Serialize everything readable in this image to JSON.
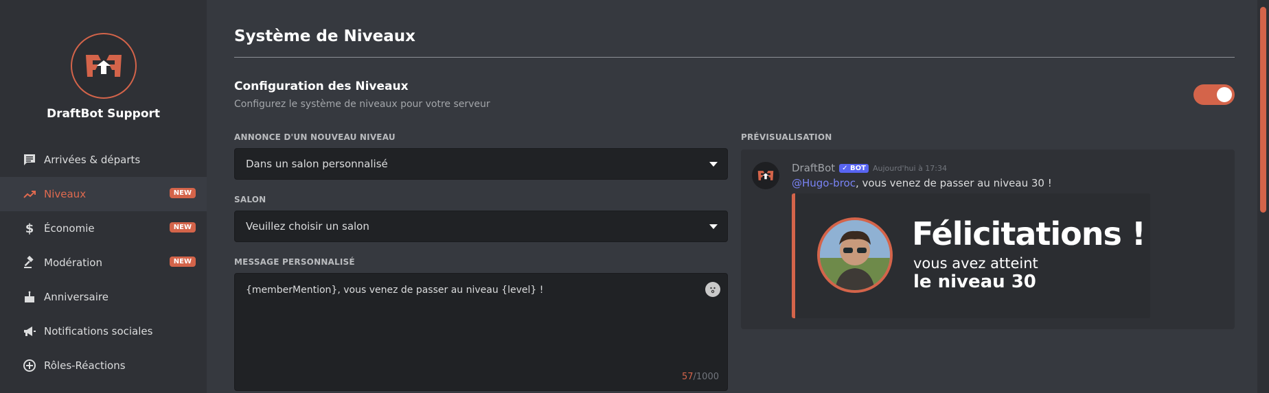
{
  "sidebar": {
    "server_name": "DraftBot Support",
    "items": [
      {
        "label": "Arrivées & départs",
        "icon": "chat-icon",
        "badge": ""
      },
      {
        "label": "Niveaux",
        "icon": "trending-up-icon",
        "badge": "NEW",
        "active": true
      },
      {
        "label": "Économie",
        "icon": "dollar-icon",
        "badge": "NEW"
      },
      {
        "label": "Modération",
        "icon": "gavel-icon",
        "badge": "NEW"
      },
      {
        "label": "Anniversaire",
        "icon": "cake-icon",
        "badge": ""
      },
      {
        "label": "Notifications sociales",
        "icon": "megaphone-icon",
        "badge": ""
      },
      {
        "label": "Rôles-Réactions",
        "icon": "add-circle-icon",
        "badge": ""
      }
    ]
  },
  "main": {
    "page_title": "Système de Niveaux",
    "section_title": "Configuration des Niveaux",
    "section_subtitle": "Configurez le système de niveaux pour votre serveur",
    "toggle_on": true,
    "announce_label": "ANNONCE D'UN NOUVEAU NIVEAU",
    "announce_value": "Dans un salon personnalisé",
    "salon_label": "SALON",
    "salon_value": "Veuillez choisir un salon",
    "message_label": "MESSAGE PERSONNALISÉ",
    "message_value": "{memberMention}, vous venez de passer au niveau {level} !",
    "char_count": "57",
    "char_max": "/1000"
  },
  "preview": {
    "label": "PRÉVISUALISATION",
    "bot_name": "DraftBot",
    "bot_tag": "✓ BOT",
    "timestamp": "Aujourd'hui à 17:34",
    "mention": "@Hugo-broc",
    "message_rest": ", vous venez de passer au niveau 30 !",
    "card_title": "Félicitations !",
    "card_line1": "vous avez atteint",
    "card_line2": "le niveau 30"
  },
  "colors": {
    "accent": "#d4644a",
    "background": "#36393f",
    "sidebar": "#2f3136",
    "mention": "#7983f5"
  }
}
